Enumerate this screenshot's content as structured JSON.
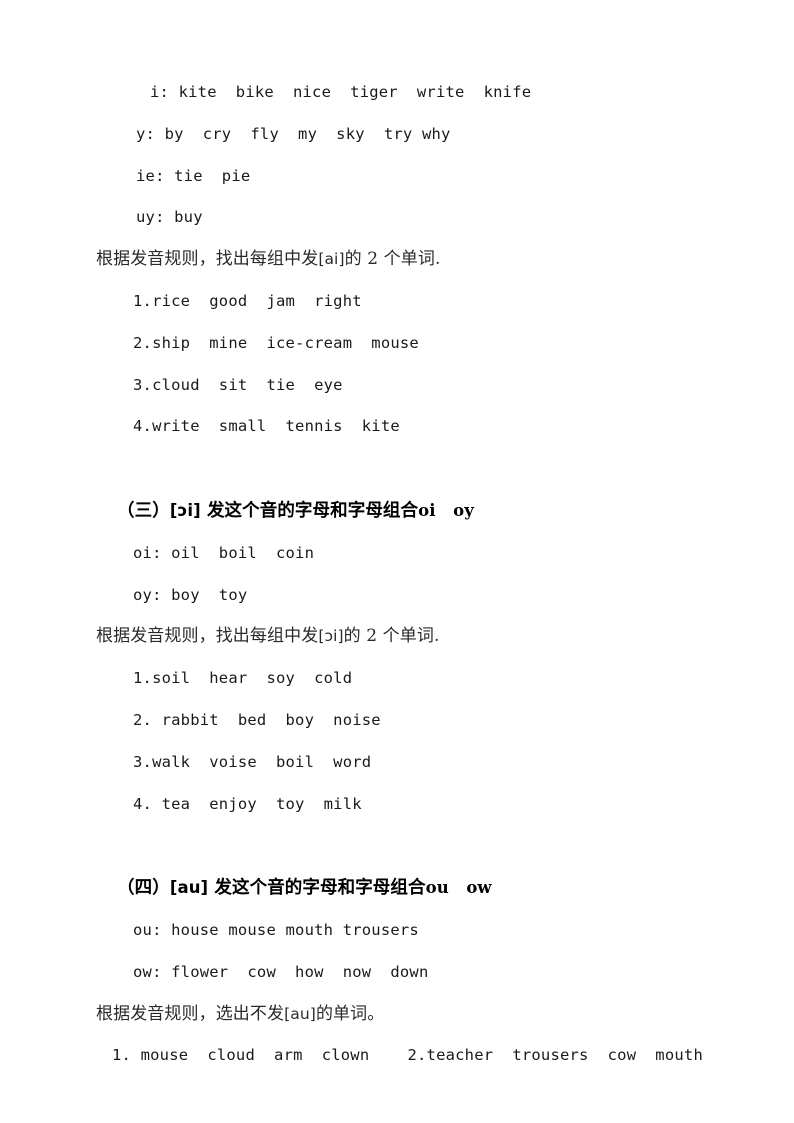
{
  "document": {
    "page_background": "#ffffff",
    "text_color": "#1a1a1a"
  },
  "section_ai_examples": [
    {
      "id": "i",
      "text": "i: kite  bike  nice  tiger  write  knife"
    },
    {
      "id": "y",
      "text": "y: by  cry  fly  my  sky  try why"
    },
    {
      "id": "ie",
      "text": "ie: tie  pie"
    },
    {
      "id": "uy",
      "text": "uy: buy"
    }
  ],
  "section_ai_instruction": {
    "prefix": "根据发音规则，找出每组中发",
    "ipa": "[ai]",
    "suffix": "的 2 个单词."
  },
  "section_ai_items": [
    {
      "number": "1.",
      "text": "1.rice  good  jam  right"
    },
    {
      "number": "2.",
      "text": "2.ship  mine  ice-cream  mouse"
    },
    {
      "number": "3.",
      "text": "3.cloud  sit  tie  eye"
    },
    {
      "number": "4.",
      "text": "4.write  small  tennis  kite"
    }
  ],
  "section_oi": {
    "heading": {
      "label": "（三）",
      "ipa": "[ɔi]",
      "description": "发这个音的字母和字母组合",
      "letters": "oi   oy"
    },
    "examples": [
      {
        "id": "oi",
        "text": "oi: oil  boil  coin"
      },
      {
        "id": "oy",
        "text": "oy: boy  toy"
      }
    ],
    "instruction": {
      "prefix": "根据发音规则，找出每组中发",
      "ipa": "[ɔi]",
      "suffix": "的 2 个单词."
    },
    "items": [
      {
        "number": "1.",
        "text": "1.soil  hear  soy  cold"
      },
      {
        "number": "2.",
        "text": "2. rabbit  bed  boy  noise"
      },
      {
        "number": "3.",
        "text": "3.walk  voise  boil  word"
      },
      {
        "number": "4.",
        "text": "4. tea  enjoy  toy  milk"
      }
    ]
  },
  "section_au": {
    "heading": {
      "label": "（四）",
      "ipa": "[au]",
      "description": "发这个音的字母和字母组合",
      "letters": "ou   ow"
    },
    "examples": [
      {
        "id": "ou",
        "text": "ou: house mouse mouth trousers"
      },
      {
        "id": "ow",
        "text": "ow: flower  cow  how  now  down"
      }
    ],
    "instruction": {
      "prefix": "根据发音规则，选出不发",
      "ipa": "[au]",
      "suffix": "的单词。"
    },
    "items": [
      {
        "number": "1.",
        "text": "1. mouse  cloud  arm  clown    2.teacher  trousers  cow  mouth"
      }
    ]
  }
}
